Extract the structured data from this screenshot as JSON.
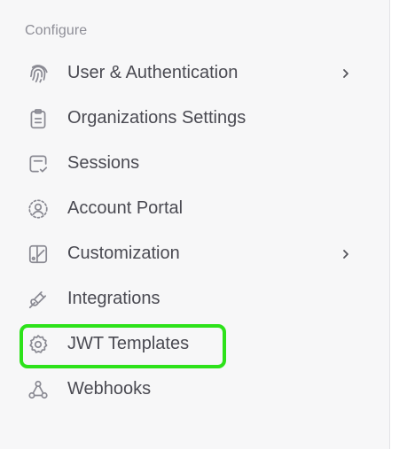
{
  "section": {
    "title": "Configure"
  },
  "menu": [
    {
      "label": "User & Authentication",
      "icon": "fingerprint-icon",
      "has_submenu": true
    },
    {
      "label": "Organizations Settings",
      "icon": "clipboard-icon",
      "has_submenu": false
    },
    {
      "label": "Sessions",
      "icon": "session-window-icon",
      "has_submenu": false
    },
    {
      "label": "Account Portal",
      "icon": "user-circle-icon",
      "has_submenu": false
    },
    {
      "label": "Customization",
      "icon": "palette-icon",
      "has_submenu": true
    },
    {
      "label": "Integrations",
      "icon": "plug-icon",
      "has_submenu": false
    },
    {
      "label": "JWT Templates",
      "icon": "badge-gear-icon",
      "has_submenu": false,
      "highlighted": true
    },
    {
      "label": "Webhooks",
      "icon": "webhook-icon",
      "has_submenu": false
    }
  ],
  "colors": {
    "sidebar_bg": "#f7f7f8",
    "text": "#4a4a52",
    "muted": "#8e8e97",
    "highlight": "#2de21a"
  }
}
